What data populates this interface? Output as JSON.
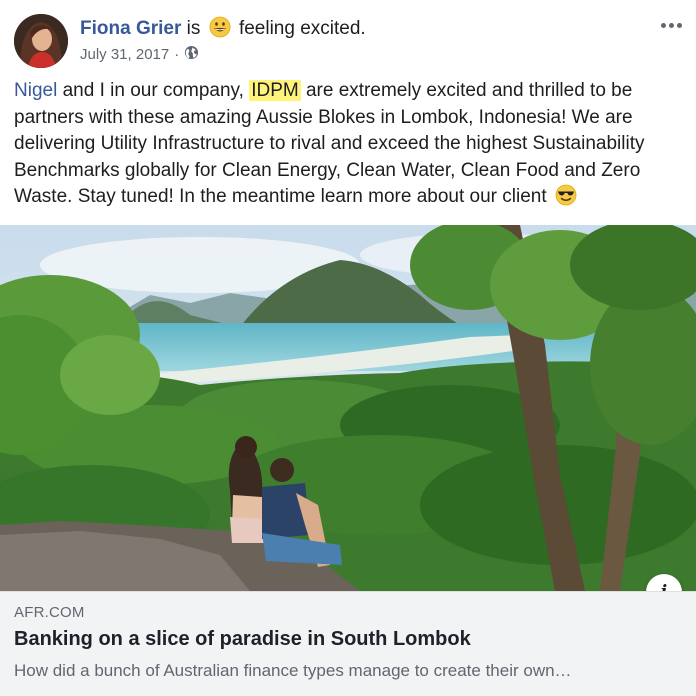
{
  "post": {
    "author_name": "Fiona Grier",
    "is_text": "is",
    "feeling_icon": "grinning-face-emoji",
    "feeling_text": "feeling excited.",
    "date": "July 31, 2017",
    "date_separator": "·",
    "privacy_icon": "globe-icon",
    "more_icon": "ellipsis-icon"
  },
  "body": {
    "mention": "Nigel",
    "text_1": "and I in our company,",
    "highlight": "IDPM",
    "text_2": "are extremely excited and thrilled to be partners with these amazing Aussie Blokes in Lombok, Indonesia! We are delivering Utility Infrastructure to rival and exceed the highest Sustainability Benchmarks globally for Clean Energy, Clean Water, Clean Food and Zero Waste. Stay tuned! In the meantime learn more about our client",
    "trailing_emoji": "sunglasses-face-emoji"
  },
  "link": {
    "image_icon": "lombok-landscape-photo",
    "info_label": "i",
    "domain": "AFR.COM",
    "title": "Banking on a slice of paradise in South Lombok",
    "description": "How did a bunch of Australian finance types manage to create their own…"
  },
  "colors": {
    "link_blue": "#385898",
    "highlight_yellow": "#fff47a",
    "preview_bg": "#f2f3f5",
    "muted_text": "#606770"
  }
}
